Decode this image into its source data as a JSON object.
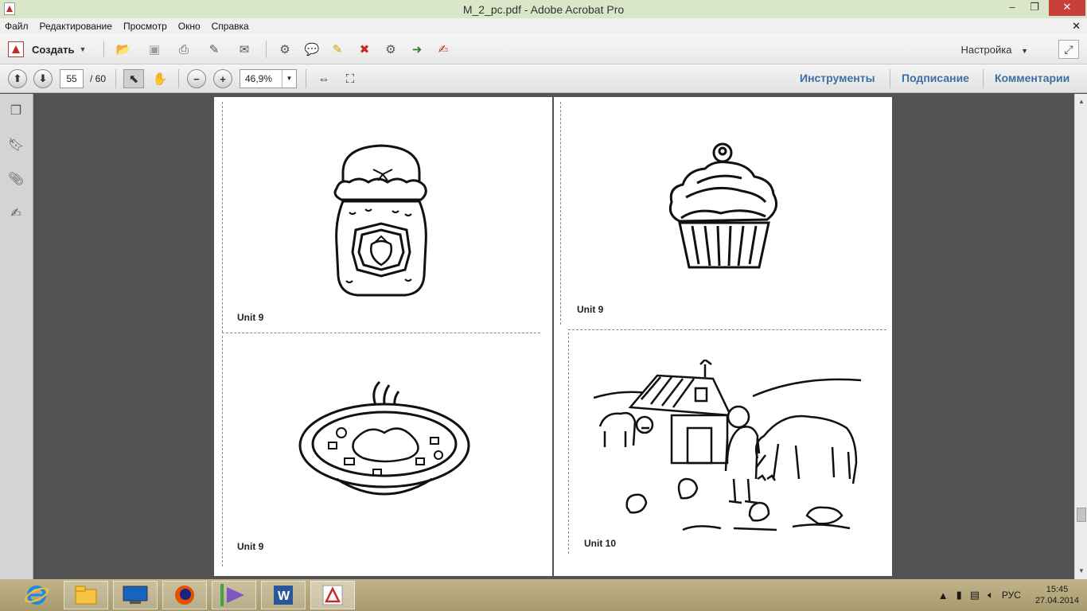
{
  "window": {
    "title": "M_2_pc.pdf - Adobe Acrobat Pro",
    "minimize": "–",
    "maximize": "❐",
    "close": "✕"
  },
  "menubar": {
    "items": [
      "Файл",
      "Редактирование",
      "Просмотр",
      "Окно",
      "Справка"
    ],
    "close": "✕"
  },
  "toolbar": {
    "create_label": "Создать",
    "settings_label": "Настройка"
  },
  "navigation": {
    "current_page": "55",
    "total_pages": "/ 60",
    "zoom": "46,9%"
  },
  "pane_tabs": [
    "Инструменты",
    "Подписание",
    "Комментарии"
  ],
  "document": {
    "cards": [
      {
        "label": "Unit 9",
        "subject": "jam-jar"
      },
      {
        "label": "Unit 9",
        "subject": "cupcake"
      },
      {
        "label": "Unit 9",
        "subject": "soup-bowl"
      },
      {
        "label": "Unit 10",
        "subject": "farm"
      }
    ]
  },
  "taskbar": {
    "apps": [
      "internet-explorer",
      "file-explorer",
      "lenovo",
      "firefox",
      "visual-studio",
      "word",
      "acrobat"
    ],
    "tray_lang": "РУС",
    "time": "15:45",
    "date": "27.04.2014"
  }
}
